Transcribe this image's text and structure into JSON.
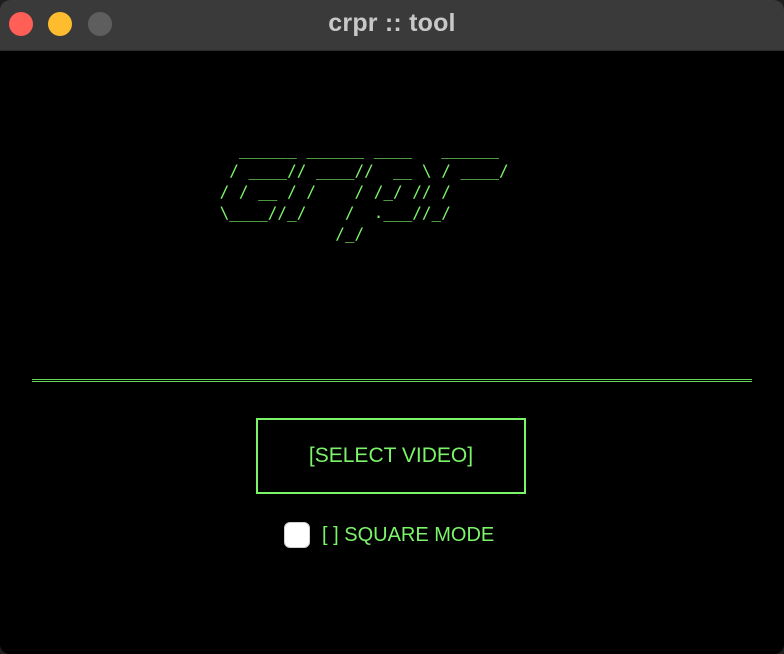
{
  "window": {
    "title": "crpr :: tool",
    "controls": {
      "close_icon": "close-icon",
      "minimize_icon": "minimize-icon",
      "maximize_icon": "maximize-icon"
    }
  },
  "logo": {
    "ascii_art": "   ______ ______ ____   ______\n  / ____// ____//  __ \\ / ____/\n / / __ / /    / /_/ // /\n \\____//_/    /  .___//_/\n             /_/"
  },
  "actions": {
    "select_video_label": "[SELECT VIDEO]"
  },
  "options": {
    "square_mode_label": "[ ] SQUARE MODE",
    "square_mode_checked": false
  },
  "colors": {
    "accent": "#7cf46a",
    "background": "#000000",
    "titlebar": "#3a3a3a"
  }
}
